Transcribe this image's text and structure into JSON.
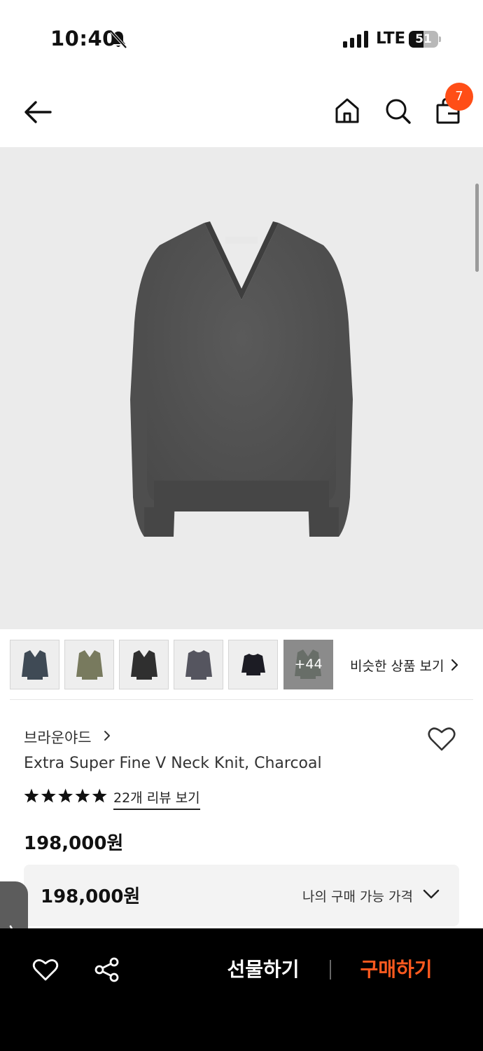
{
  "status_bar": {
    "time": "10:40",
    "network": "LTE",
    "battery": "51",
    "battery_level": 0.51
  },
  "header": {
    "cart_count": "7",
    "icons": [
      "back-arrow-icon",
      "home-icon",
      "search-icon",
      "shopping-bag-icon"
    ]
  },
  "thumbnails": {
    "more_label": "+44",
    "similar_label": "비슷한 상품 보기"
  },
  "product": {
    "brand": "브라운야드",
    "name": "Extra Super Fine V Neck Knit, Charcoal",
    "rating_stars": 5,
    "review_label": "22개 리뷰 보기",
    "price": "198,000원"
  },
  "price_box": {
    "value": "198,000원",
    "label": "나의 구매 가능 가격"
  },
  "bottom_bar": {
    "gift_label": "선물하기",
    "buy_label": "구매하기"
  },
  "colors": {
    "accent": "#ff4e17",
    "buy": "#ff5a1f",
    "hero_bg": "#ebebeb",
    "bottom_bg": "#000000"
  }
}
